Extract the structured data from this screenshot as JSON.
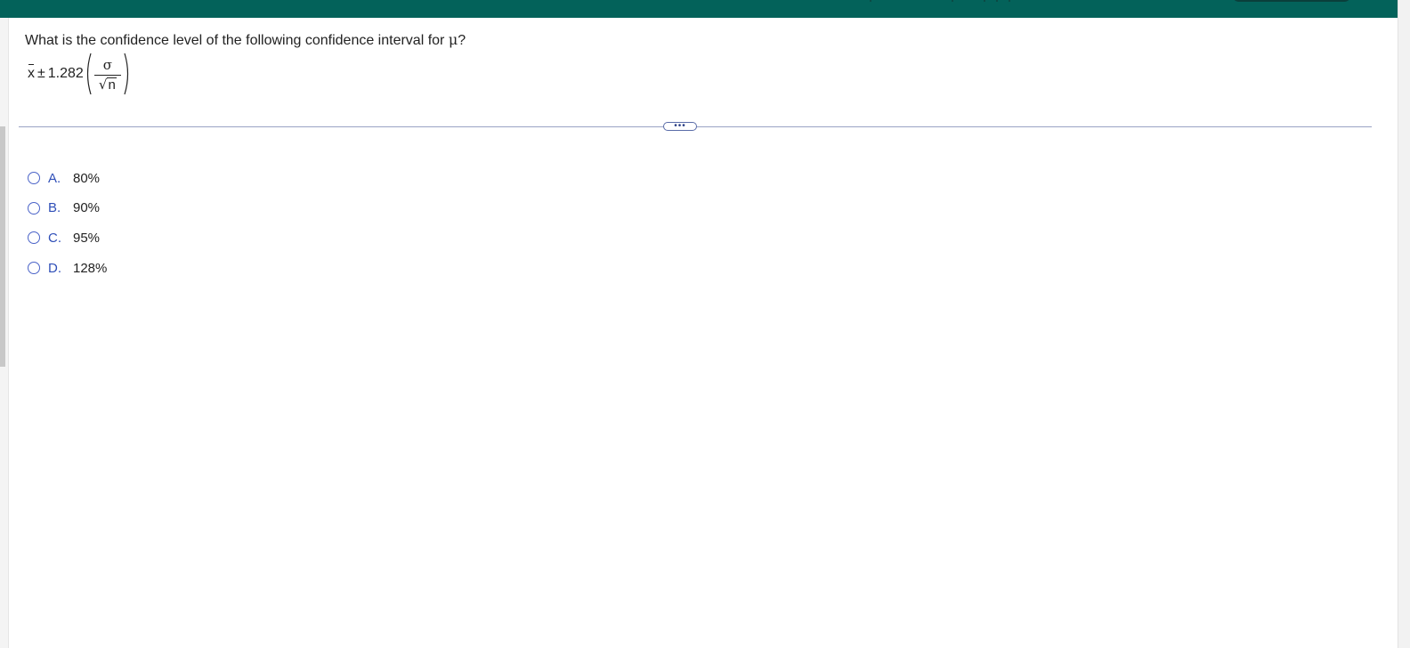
{
  "question": {
    "text": "What is the confidence level of the following confidence interval for",
    "symbol": "μ",
    "end": "?"
  },
  "formula": {
    "xbar": "x",
    "pm": "±",
    "z": "1.282",
    "left_paren": "(",
    "numerator": "σ",
    "sqrt_symbol": "√",
    "sqrt_arg": "n",
    "right_paren": ")"
  },
  "more_button": {
    "label": "•••"
  },
  "options": [
    {
      "letter": "A.",
      "value": "80%"
    },
    {
      "letter": "B.",
      "value": "90%"
    },
    {
      "letter": "C.",
      "value": "95%"
    },
    {
      "letter": "D.",
      "value": "128%"
    }
  ],
  "colors": {
    "topbar": "#03625a",
    "accent_blue": "#2f4fb8",
    "divider": "#9aa3c4"
  }
}
